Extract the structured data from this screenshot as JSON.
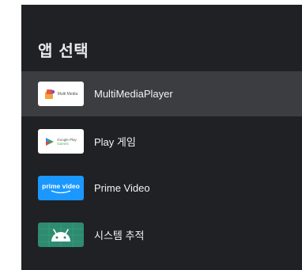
{
  "dialog": {
    "title": "앱 선택"
  },
  "apps": [
    {
      "label": "MultiMediaPlayer",
      "thumb_text": "Multi Media",
      "icon": "multimedia-player-icon",
      "selected": true
    },
    {
      "label": "Play 게임",
      "thumb_text_line1": "Google Play",
      "thumb_text_line2": "Games",
      "icon": "google-play-games-icon",
      "selected": false
    },
    {
      "label": "Prime Video",
      "thumb_text": "prime video",
      "icon": "prime-video-icon",
      "selected": false
    },
    {
      "label": "시스템 추적",
      "icon": "android-system-tracing-icon",
      "selected": false
    }
  ],
  "colors": {
    "panel_bg": "#202124",
    "selected_row": "#3b3d41",
    "prime_blue": "#1a98ff",
    "android_green": "#2e8b6f"
  }
}
